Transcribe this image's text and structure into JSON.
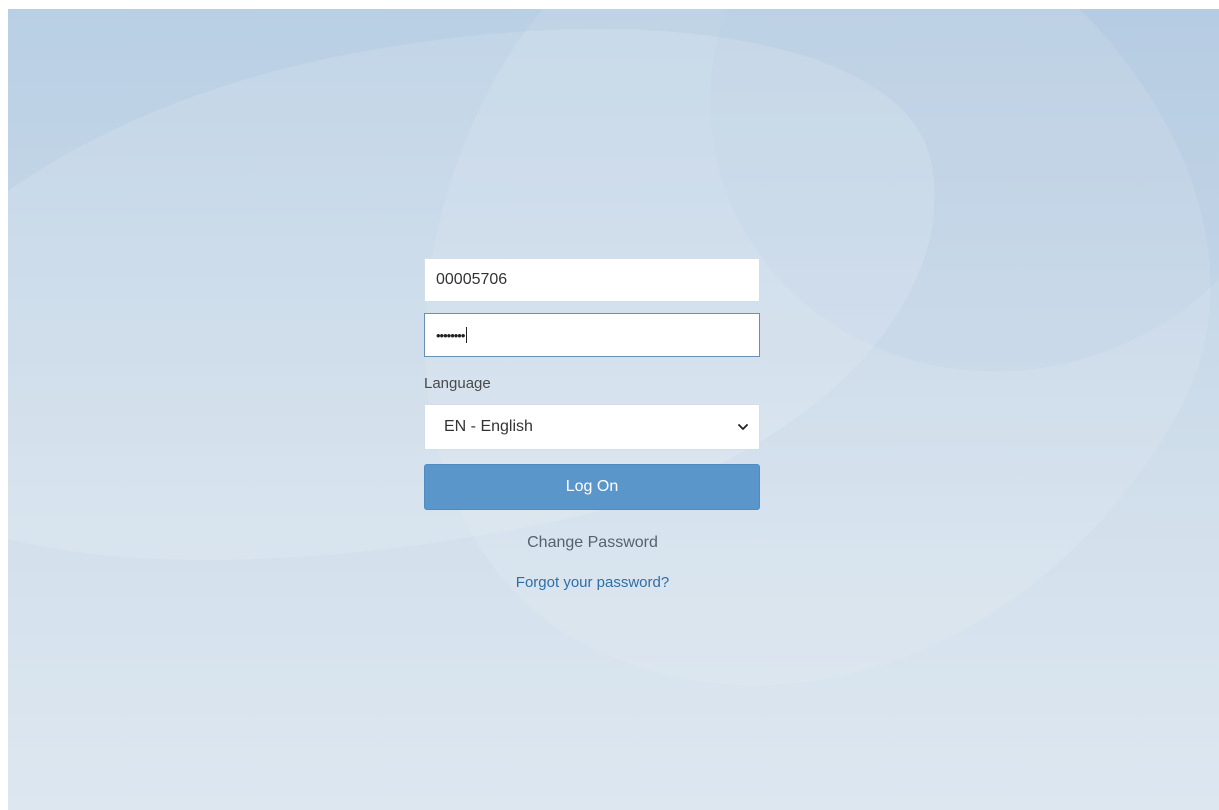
{
  "login": {
    "username_value": "00005706",
    "password_mask": "••••••••",
    "language_label": "Language",
    "language_selected": "EN - English",
    "logon_label": "Log On",
    "change_password_label": "Change Password",
    "forgot_password_label": "Forgot your password?"
  },
  "icons": {
    "dropdown": "chevron-down-icon"
  },
  "colors": {
    "button_bg": "#5b96cb",
    "link": "#2f6ea6"
  }
}
